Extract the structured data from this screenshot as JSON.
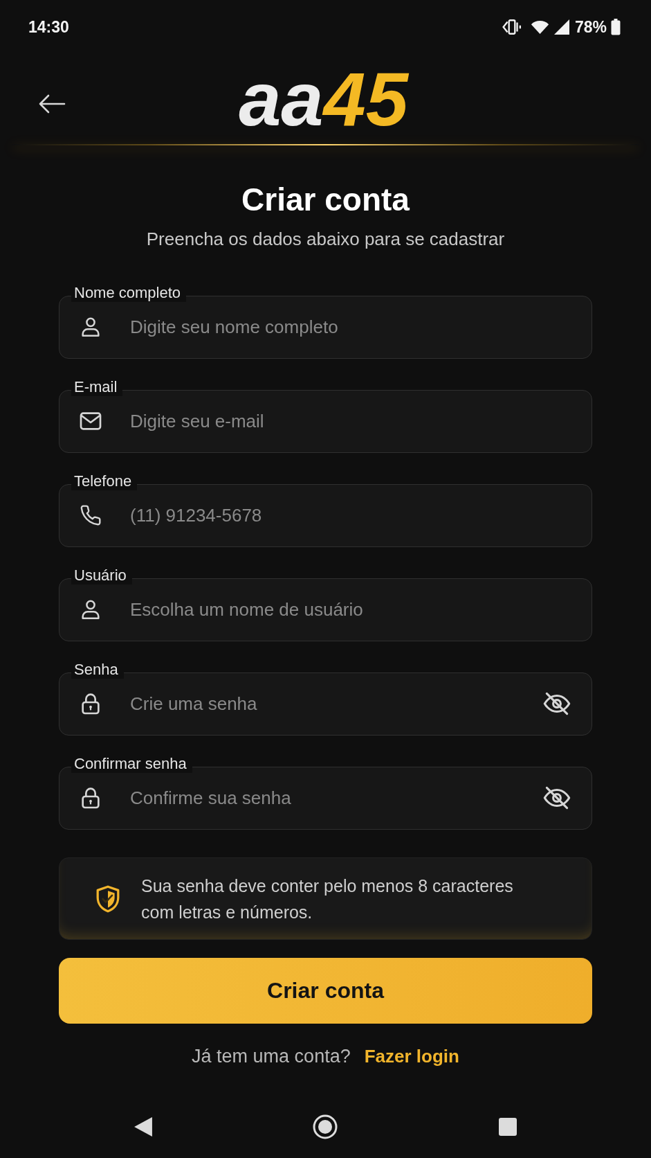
{
  "status_bar": {
    "time": "14:30",
    "battery": "78%"
  },
  "header": {
    "logo": {
      "primary": "aa",
      "accent": "45"
    }
  },
  "title": "Criar conta",
  "subtitle": "Preencha os dados abaixo para se cadastrar",
  "fields": [
    {
      "kind": "name",
      "label": "Nome completo",
      "placeholder": "Digite seu nome completo"
    },
    {
      "kind": "email",
      "label": "E-mail",
      "placeholder": "Digite seu e-mail"
    },
    {
      "kind": "phone",
      "label": "Telefone",
      "placeholder": "(11) 91234-5678"
    },
    {
      "kind": "username",
      "label": "Usuário",
      "placeholder": "Escolha um nome de usuário"
    },
    {
      "kind": "password",
      "label": "Senha",
      "placeholder": "Crie uma senha"
    },
    {
      "kind": "password",
      "label": "Confirmar senha",
      "placeholder": "Confirme sua senha"
    }
  ],
  "password_hint": "Sua senha deve conter pelo menos 8 caracteres com letras e números.",
  "submit_button": "Criar conta",
  "login_prompt": {
    "text": "Já tem uma conta?",
    "link": "Fazer login"
  }
}
